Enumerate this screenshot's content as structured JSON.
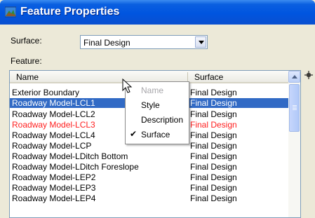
{
  "window": {
    "title": "Feature Properties"
  },
  "surface": {
    "label": "Surface:",
    "value": "Final Design"
  },
  "feature": {
    "label": "Feature:"
  },
  "table": {
    "columns": [
      "Name",
      "Surface"
    ],
    "rows": [
      {
        "name": "Exterior Boundary",
        "surface": "Final Design"
      },
      {
        "name": "Roadway Model-LCL1",
        "surface": "Final Design"
      },
      {
        "name": "Roadway Model-LCL2",
        "surface": "Final Design"
      },
      {
        "name": "Roadway Model-LCL3",
        "surface": "Final Design"
      },
      {
        "name": "Roadway Model-LCL4",
        "surface": "Final Design"
      },
      {
        "name": "Roadway Model-LCP",
        "surface": "Final Design"
      },
      {
        "name": "Roadway Model-LDitch Bottom",
        "surface": "Final Design"
      },
      {
        "name": "Roadway Model-LDitch Foreslope",
        "surface": "Final Design"
      },
      {
        "name": "Roadway Model-LEP2",
        "surface": "Final Design"
      },
      {
        "name": "Roadway Model-LEP3",
        "surface": "Final Design"
      },
      {
        "name": "Roadway Model-LEP4",
        "surface": "Final Design"
      }
    ]
  },
  "context_menu": {
    "items": [
      {
        "label": "Name",
        "enabled": false,
        "checked": false
      },
      {
        "label": "Style",
        "enabled": true,
        "checked": false
      },
      {
        "label": "Description",
        "enabled": true,
        "checked": false
      },
      {
        "label": "Surface",
        "enabled": true,
        "checked": true
      }
    ],
    "check_glyph": "✔"
  },
  "colors": {
    "title_bar": "#0055df",
    "selection": "#316ac5",
    "red_row": "#ff2020",
    "disabled": "#a7a6aa"
  },
  "icons": [
    "app-icon",
    "dropdown-arrow-icon",
    "scroll-up-arrow-icon",
    "pointer-cursor-icon",
    "crosshair-tool-icon"
  ]
}
